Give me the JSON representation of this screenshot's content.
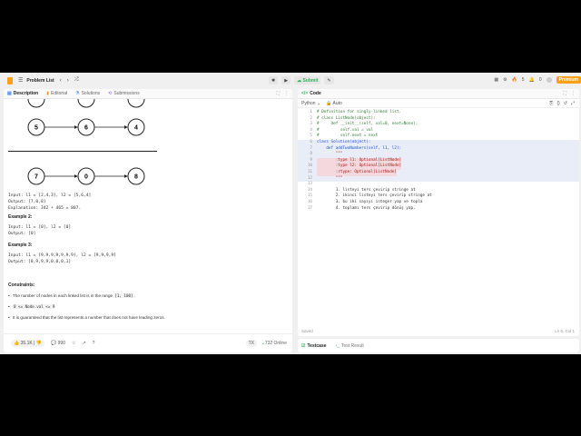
{
  "topbar": {
    "title": "Problem List",
    "center": [
      "Run",
      "Submit"
    ],
    "right": [
      "5",
      "0",
      "Premium"
    ]
  },
  "left_tabs": [
    {
      "label": "Description",
      "icon": "document-icon"
    },
    {
      "label": "Editorial",
      "icon": "book-icon"
    },
    {
      "label": "Solutions",
      "icon": "flask-icon"
    },
    {
      "label": "Submissions",
      "icon": "history-icon"
    }
  ],
  "diagram": {
    "row1": [
      "5",
      "6",
      "4"
    ],
    "row2": [
      "7",
      "0",
      "8"
    ]
  },
  "example1": {
    "input": "Input: l1 = [2,4,3], l2 = [5,6,4]",
    "output": "Output: [7,0,8]",
    "explanation": "Explanation: 342 + 465 = 807."
  },
  "example2": {
    "title": "Example 2:",
    "input": "Input: l1 = [0], l2 = [0]",
    "output": "Output: [0]"
  },
  "example3": {
    "title": "Example 3:",
    "input": "Input: l1 = [9,9,9,9,9,9,9], l2 = [9,9,9,9]",
    "output": "Output: [8,9,9,9,0,0,0,1]"
  },
  "constraints": {
    "title": "Constraints:",
    "c1_text": "The number of nodes in each linked list is in the range",
    "c1_code": "[1, 100]",
    "c2_code": "0 <= Node.val <= 9",
    "c3_text": "It is guaranteed that the list represents a number that does not have leading zeros."
  },
  "footer": {
    "likes": "35.1K",
    "dislikes": "",
    "comments": "990",
    "online": "732 Online",
    "tx": "TX"
  },
  "code_tab": {
    "label": "Code",
    "lang": "Python",
    "auto": "Auto"
  },
  "code_lines": [
    {
      "n": "1",
      "t": "# Definition for singly-linked list."
    },
    {
      "n": "2",
      "t": "# class ListNode(object):"
    },
    {
      "n": "3",
      "t": "#     def __init__(self, val=0, next=None):"
    },
    {
      "n": "4",
      "t": "#         self.val = val"
    },
    {
      "n": "5",
      "t": "#         self.next = next"
    },
    {
      "n": "6",
      "t": "class Solution(object):"
    },
    {
      "n": "7",
      "t": "    def addTwoNumbers(self, l1, l2):"
    },
    {
      "n": "8",
      "t": "        \"\"\""
    },
    {
      "n": "9",
      "t": "        :type l1: Optional[ListNode]"
    },
    {
      "n": "10",
      "t": "        :type l2: Optional[ListNode]"
    },
    {
      "n": "11",
      "t": "        :rtype: Optional[ListNode]"
    },
    {
      "n": "12",
      "t": "        \"\"\""
    },
    {
      "n": "13",
      "t": ""
    },
    {
      "n": "14",
      "t": "        1. listeyi ters çevirip stringe at"
    },
    {
      "n": "15",
      "t": "        2. ikinci listeyi ters çevirip stringe at"
    },
    {
      "n": "16",
      "t": "        3. bu iki sayıyı integer yap ve topla"
    },
    {
      "n": "17",
      "t": "        4. toplamı ters çevirip dönüş yap."
    }
  ],
  "status": {
    "left": "Saved",
    "right": "Ln 6, Col 1"
  },
  "bottom_tabs": [
    "Testcase",
    "Test Result"
  ]
}
